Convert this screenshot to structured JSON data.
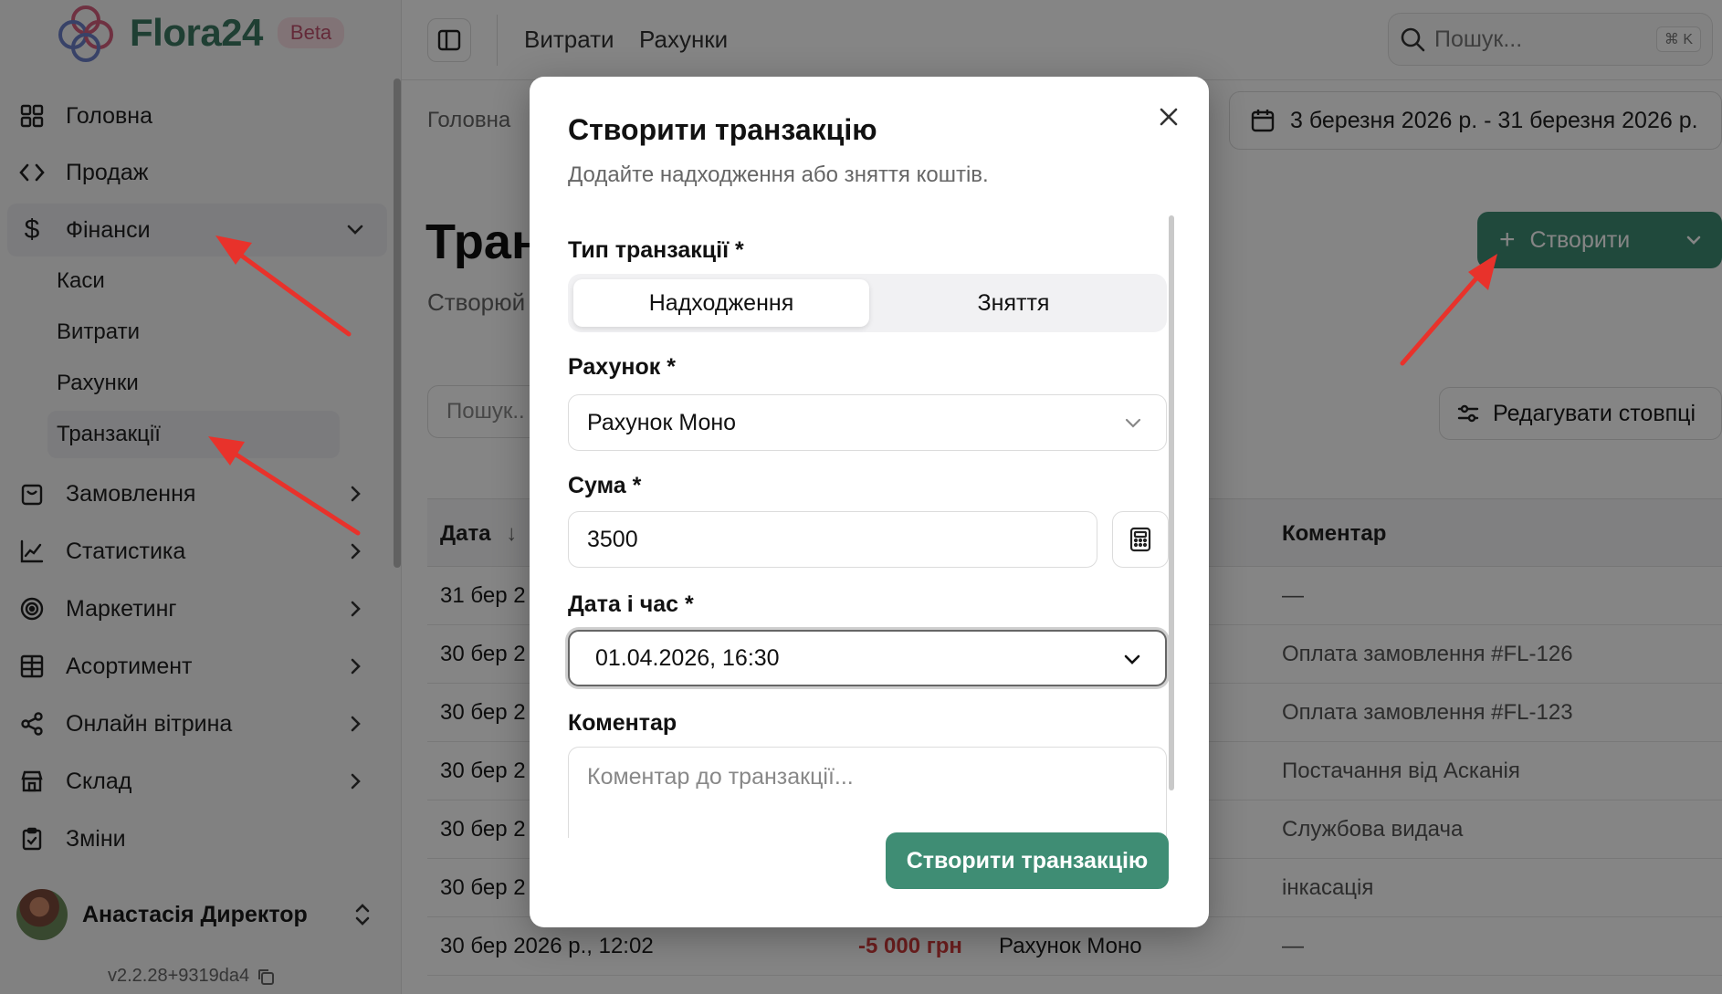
{
  "app": {
    "name": "Flora24",
    "badge": "Beta",
    "version": "v2.2.28+9319da4"
  },
  "sidebar": {
    "items": [
      {
        "label": "Головна",
        "icon": "grid-icon"
      },
      {
        "label": "Продаж",
        "icon": "code-icon"
      },
      {
        "label": "Фінанси",
        "icon": "dollar-icon",
        "expanded": true
      },
      {
        "label": "Замовлення",
        "icon": "shopping-bag-icon"
      },
      {
        "label": "Статистика",
        "icon": "chart-icon"
      },
      {
        "label": "Маркетинг",
        "icon": "target-icon"
      },
      {
        "label": "Асортимент",
        "icon": "table-icon"
      },
      {
        "label": "Онлайн вітрина",
        "icon": "share-icon"
      },
      {
        "label": "Склад",
        "icon": "store-icon"
      },
      {
        "label": "Зміни",
        "icon": "clipboard-icon"
      }
    ],
    "finance_sub": [
      "Каси",
      "Витрати",
      "Рахунки",
      "Транзакції"
    ],
    "user": {
      "name": "Анастасія Директор"
    }
  },
  "topbar": {
    "links": [
      "Витрати",
      "Рахунки"
    ],
    "search_placeholder": "Пошук...",
    "shortcut": "⌘ K"
  },
  "main": {
    "breadcrumb": "Головна",
    "date_range": "3 березня 2026 р. - 31 березня 2026 р.",
    "title": "Тран",
    "subtitle": "Створюй",
    "create_label": "Створити",
    "edit_columns_label": "Редагувати стовпці",
    "search_placeholder": "Пошук..",
    "table": {
      "headers": [
        "Дата",
        "Коментар"
      ],
      "rows": [
        {
          "date": "31 бер 2",
          "comment": "—"
        },
        {
          "date": "30 бер 2",
          "comment": "Оплата замовлення #FL-126"
        },
        {
          "date": "30 бер 2",
          "comment": "Оплата замовлення #FL-123"
        },
        {
          "date": "30 бер 2",
          "comment": "Постачання від Асканія"
        },
        {
          "date": "30 бер 2",
          "comment": "Службова видача"
        },
        {
          "date": "30 бер 2",
          "comment": "інкасація"
        },
        {
          "date": "30 бер 2026 р., 12:02",
          "amount": "-5 000 грн",
          "account": "Рахунок Моно",
          "comment": "—"
        }
      ]
    }
  },
  "modal": {
    "title": "Створити транзакцію",
    "description": "Додайте надходження або зняття коштів.",
    "type_label": "Тип транзакції *",
    "type_options": [
      "Надходження",
      "Зняття"
    ],
    "account_label": "Рахунок *",
    "account_value": "Рахунок Моно",
    "amount_label": "Сума *",
    "amount_value": "3500",
    "datetime_label": "Дата і час *",
    "datetime_value": "01.04.2026, 16:30",
    "comment_label": "Коментар",
    "comment_placeholder": "Коментар до транзакції...",
    "submit_label": "Створити транзакцію"
  },
  "colors": {
    "accent": "#3f8d74",
    "arrow": "#e8322b",
    "negative": "#d23a3a"
  }
}
